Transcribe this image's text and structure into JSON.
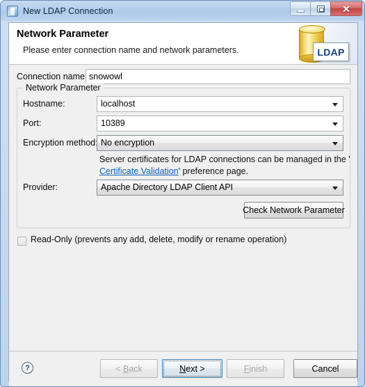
{
  "window": {
    "title": "New LDAP Connection",
    "icon": "ldap-connection-icon",
    "buttons": {
      "minimize": "minimize-icon",
      "maximize": "maximize-icon",
      "close_glyph": "✕"
    }
  },
  "wizard_header": {
    "title": "Network Parameter",
    "subtitle": "Please enter connection name and network parameters.",
    "logo_text": "LDAP"
  },
  "form": {
    "connection_name": {
      "label": "Connection name:",
      "value": "snowowl",
      "placeholder": ""
    },
    "group": {
      "legend": "Network Parameter",
      "hostname": {
        "label": "Hostname:",
        "value": "localhost"
      },
      "port": {
        "label": "Port:",
        "value": "10389"
      },
      "encryption": {
        "label": "Encryption method:",
        "value": "No encryption"
      },
      "cert_note_line1": "Server certificates for LDAP connections can be managed in the '",
      "cert_note_link": "Certificate Validation",
      "cert_note_line2": "' preference page.",
      "provider": {
        "label": "Provider:",
        "value": "Apache Directory LDAP Client API"
      },
      "check_button": "Check Network Parameter"
    },
    "read_only": {
      "label": "Read-Only (prevents any add, delete, modify or rename operation)",
      "checked": false
    }
  },
  "button_bar": {
    "help": "?",
    "back": {
      "label": "< Back",
      "mnemonic": "B",
      "enabled": false
    },
    "next": {
      "label": "Next >",
      "mnemonic": "N",
      "enabled": true,
      "default": true
    },
    "finish": {
      "label": "Finish",
      "mnemonic": "F",
      "enabled": false
    },
    "cancel": {
      "label": "Cancel",
      "enabled": true
    }
  },
  "colors": {
    "titlebar": "#b4cdeb",
    "dialog_bg": "#f0f0f0",
    "link": "#0d5fbd",
    "close_button": "#bf4444",
    "default_button_border": "#3c7fb1"
  }
}
